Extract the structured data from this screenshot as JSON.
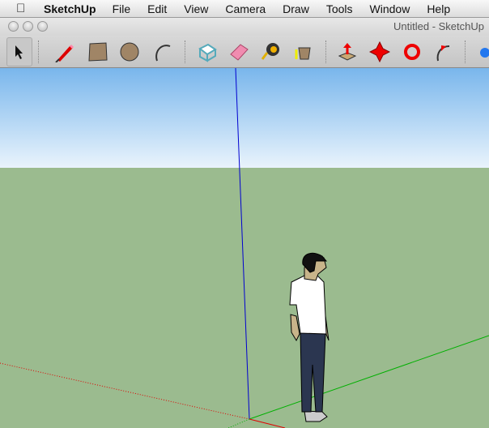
{
  "menubar": {
    "app": "SketchUp",
    "items": [
      "File",
      "Edit",
      "View",
      "Camera",
      "Draw",
      "Tools",
      "Window",
      "Help"
    ]
  },
  "window": {
    "title": "Untitled - SketchUp"
  },
  "toolbar": {
    "tools": [
      "select-icon",
      "pencil-icon",
      "rectangle-icon",
      "circle-icon",
      "arc-icon",
      "make-component-icon",
      "eraser-icon",
      "tape-measure-icon",
      "paint-bucket-icon",
      "push-pull-icon",
      "move-icon",
      "rotate-icon",
      "follow-me-icon",
      "offset-icon"
    ]
  },
  "colors": {
    "sky": "#79b6ec",
    "ground": "#9bbb8f",
    "axis_red": "#e00000",
    "axis_green": "#00b000",
    "axis_blue": "#0000d0"
  }
}
